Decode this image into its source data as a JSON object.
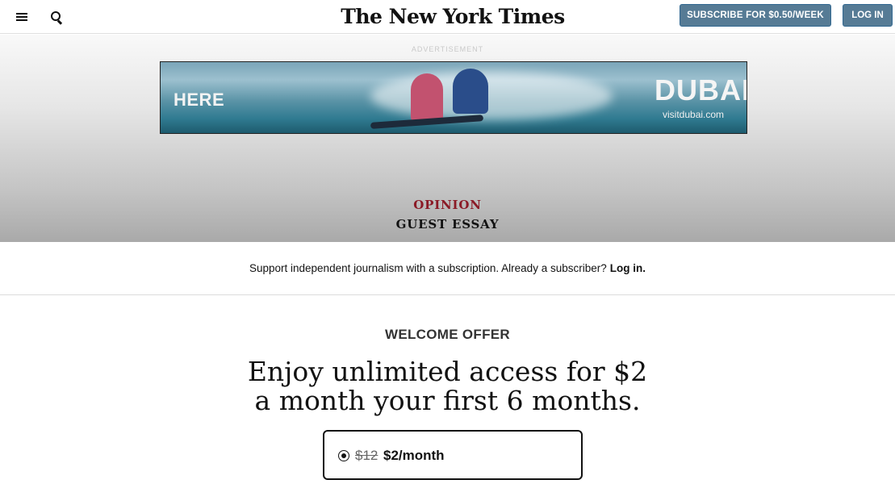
{
  "header": {
    "masthead": "The New York Times",
    "subscribe_label": "SUBSCRIBE FOR $0.50/WEEK",
    "login_label": "LOG IN",
    "menu_icon": "hamburger-menu-icon",
    "search_icon": "search-icon"
  },
  "ad": {
    "label": "ADVERTISEMENT",
    "headline": "HERE",
    "brand": "DUBAI",
    "url": "visitdubai.com"
  },
  "article": {
    "section": "OPINION",
    "type": "GUEST ESSAY"
  },
  "support": {
    "text": "Support independent journalism with a subscription. Already a subscriber?",
    "login_link": "Log in."
  },
  "offer": {
    "label": "WELCOME OFFER",
    "headline_line1": "Enjoy unlimited access for $2",
    "headline_line2": "a month your first 6 months.",
    "plan_old_price": "$12",
    "plan_new_price": "$2/month",
    "plan_selected": true
  },
  "colors": {
    "button_bg": "#567b95",
    "opinion_red": "#8b1a26"
  }
}
